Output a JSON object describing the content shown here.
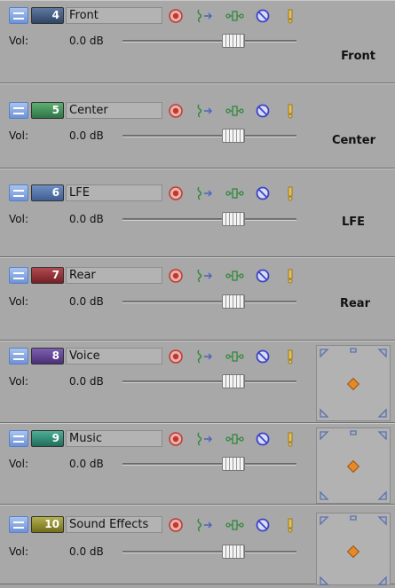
{
  "vol_label": "Vol:",
  "tracks": [
    {
      "number": "4",
      "name": "Front",
      "color": "#3d577c",
      "volume": "0.0 dB",
      "output": "Front"
    },
    {
      "number": "5",
      "name": "Center",
      "color": "#3f8a55",
      "volume": "0.0 dB",
      "output": "Center"
    },
    {
      "number": "6",
      "name": "LFE",
      "color": "#4c6fa3",
      "volume": "0.0 dB",
      "output": "LFE"
    },
    {
      "number": "7",
      "name": "Rear",
      "color": "#8c2a2f",
      "volume": "0.0 dB",
      "output": "Rear"
    },
    {
      "number": "8",
      "name": "Voice",
      "color": "#5b3c8a",
      "volume": "0.0 dB",
      "output": ""
    },
    {
      "number": "9",
      "name": "Music",
      "color": "#2f8873",
      "volume": "0.0 dB",
      "output": ""
    },
    {
      "number": "10",
      "name": "Sound Effects",
      "color": "#8c8a2e",
      "volume": "0.0 dB",
      "output": ""
    }
  ],
  "icons": {
    "arm": "record-arm-icon",
    "automation": "automation-icon",
    "fx": "track-fx-icon",
    "mute": "mute-icon",
    "solo": "solo-icon"
  }
}
